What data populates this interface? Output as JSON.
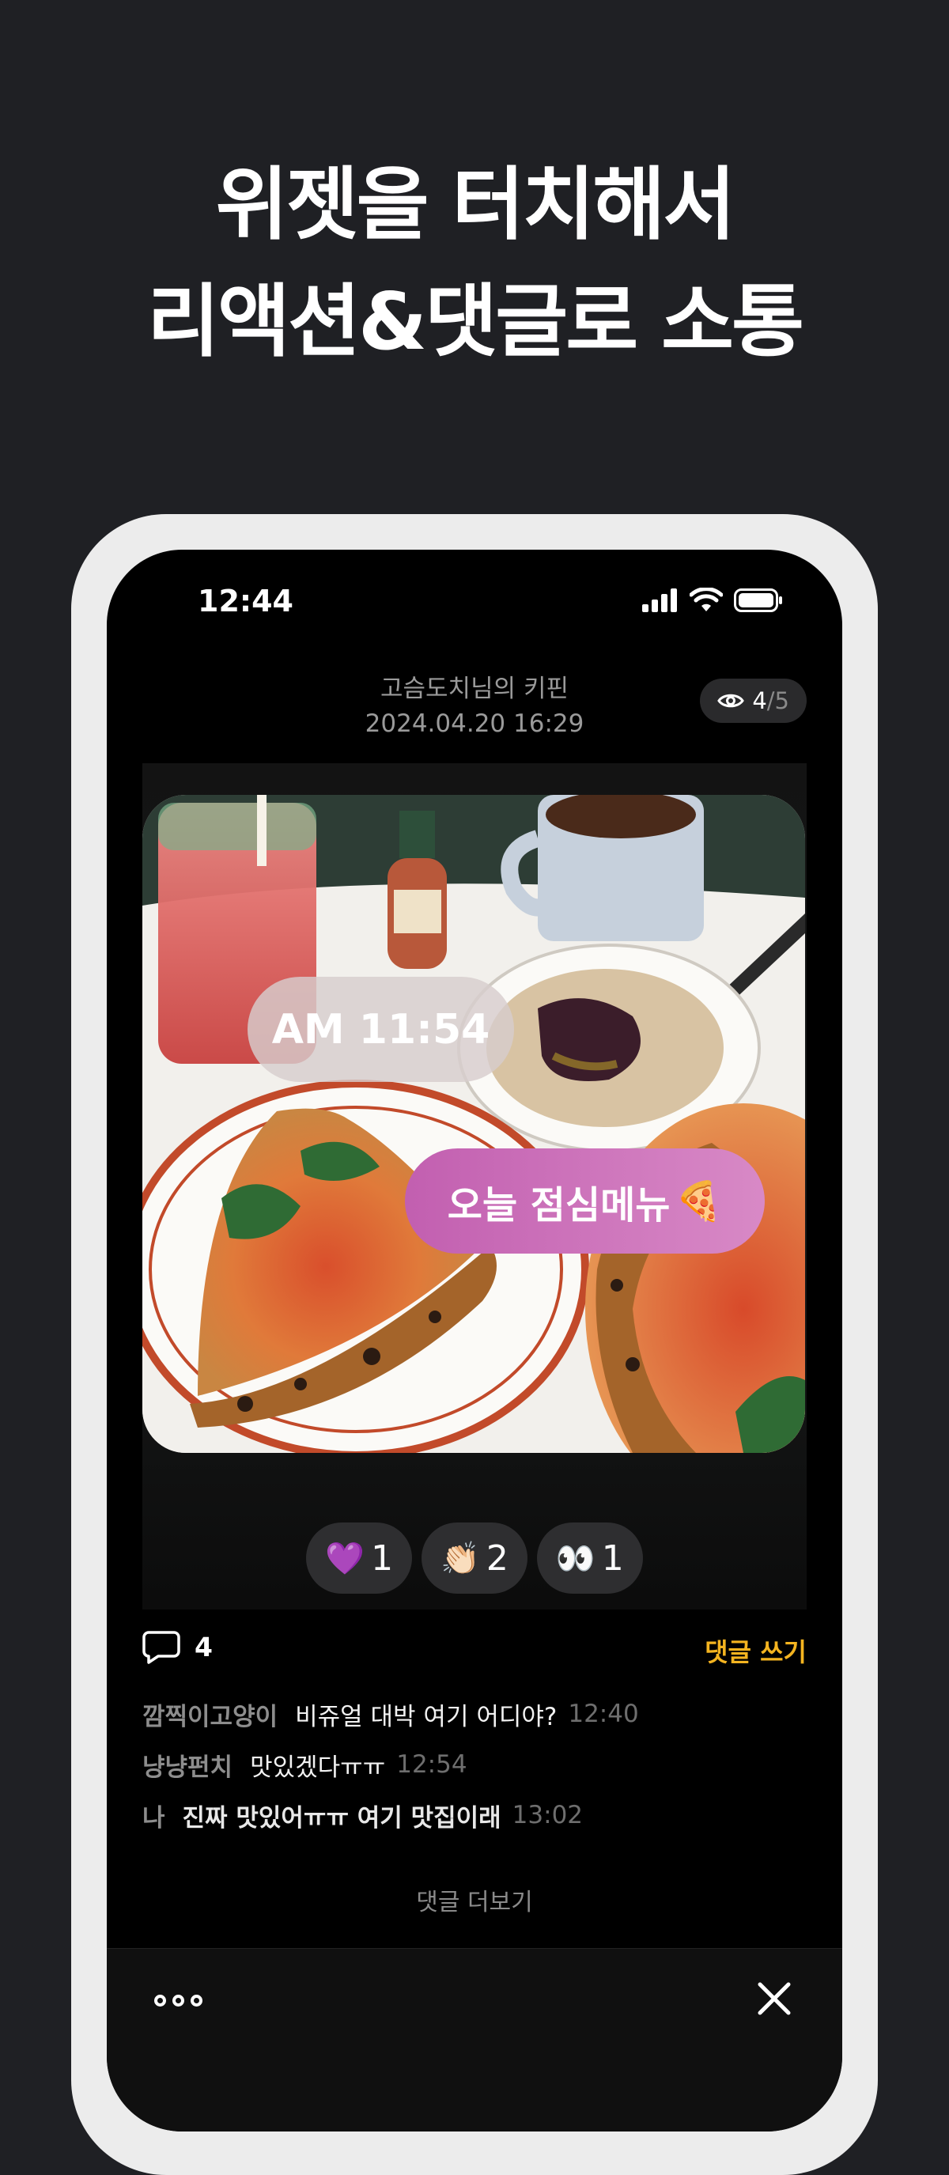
{
  "headline": {
    "line1": "위젯을 터치해서",
    "line2": "리액션&댓글로 소통"
  },
  "status_bar": {
    "time": "12:44",
    "icons": [
      "signal-icon",
      "wifi-icon",
      "battery-icon"
    ]
  },
  "post": {
    "owner": "고슴도치님의 키핀",
    "date": "2024.04.20 16:29",
    "views": {
      "count": "4",
      "total": "/5"
    },
    "time_bubble": "AM 11:54",
    "memo_bubble": "오늘 점심메뉴",
    "memo_emoji": "🍕"
  },
  "reactions": [
    {
      "emoji": "💜",
      "count": "1"
    },
    {
      "emoji": "👏🏻",
      "count": "2"
    },
    {
      "emoji": "👀",
      "count": "1"
    }
  ],
  "comments_section": {
    "count": "4",
    "write_label": "댓글 쓰기",
    "more_label": "댓글 더보기",
    "items": [
      {
        "author": "깜찍이고양이",
        "text": "비쥬얼 대박 여기 어디야?",
        "time": "12:40"
      },
      {
        "author": "냥냥펀치",
        "text": "맛있겠다ㅠㅠ",
        "time": "12:54"
      },
      {
        "author": "나",
        "text": "진짜 맛있어ㅠㅠ 여기 맛집이래",
        "time": "13:02"
      }
    ]
  },
  "colors": {
    "background": "#1f2024",
    "accent": "#f4b420",
    "memo_bubble": "#c25fb0"
  }
}
